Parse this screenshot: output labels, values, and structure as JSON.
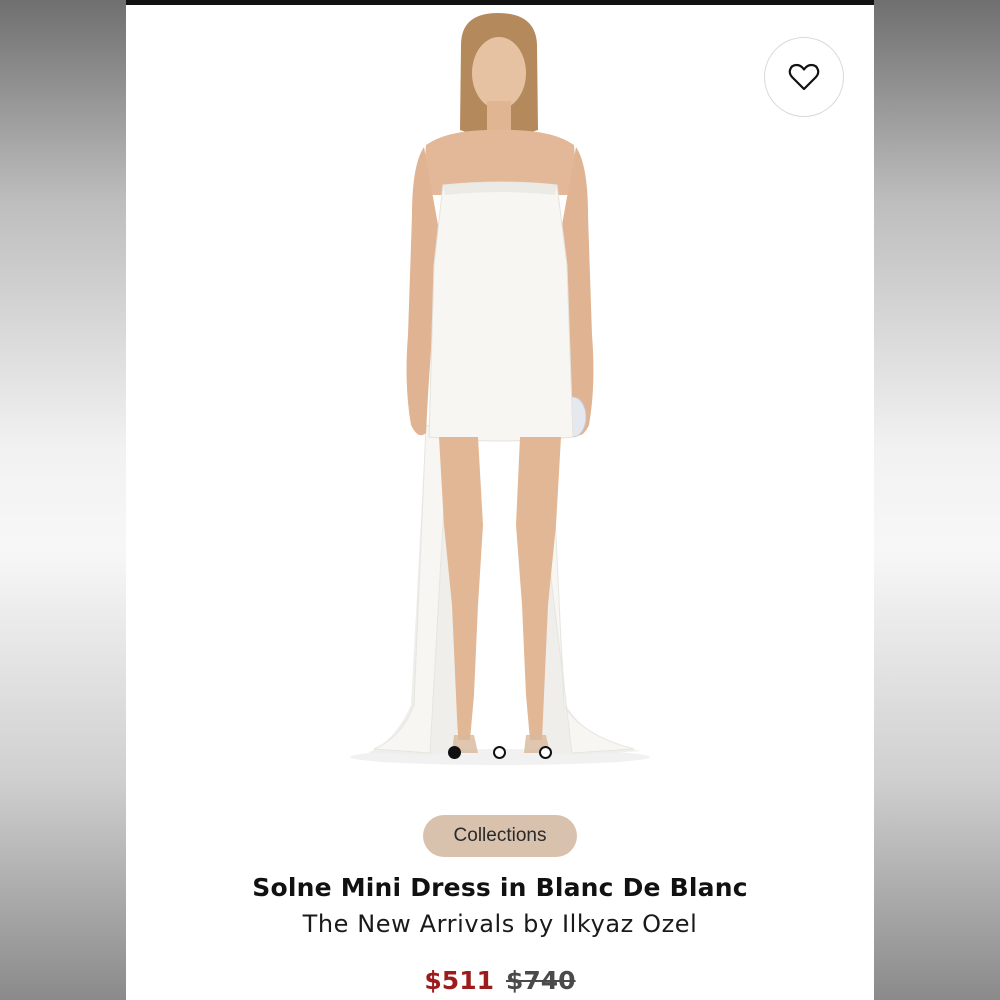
{
  "gallery": {
    "total_images": 3,
    "active_index": 0
  },
  "favorite": {
    "icon": "heart-icon"
  },
  "product": {
    "category_chip": "Collections",
    "title": "Solne Mini Dress in Blanc De Blanc",
    "brand_line": "The New Arrivals by Ilkyaz Ozel",
    "sale_price": "$511",
    "original_price": "$740"
  },
  "colors": {
    "sale_price": "#9c1b1b",
    "chip_background": "#d9c2ad",
    "dress": "#f7f6f2"
  }
}
